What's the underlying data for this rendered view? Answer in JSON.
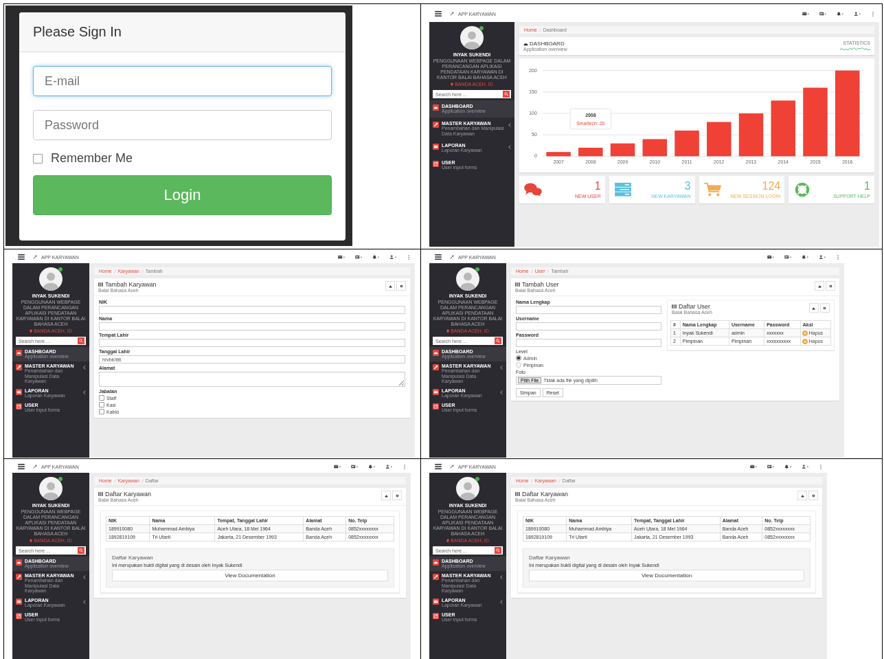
{
  "panels": [
    {
      "kind": "login",
      "title": "Please Sign In",
      "fields": [
        {
          "placeholder": "E-mail",
          "focused": true
        },
        {
          "placeholder": "Password",
          "focused": false
        }
      ],
      "remember": {
        "label": "Remember Me",
        "checked": false
      },
      "button": "Login"
    },
    {
      "kind": "app",
      "brand": "APP KARYAWAN",
      "sidebar": {
        "name": "INYAK SUKENDI",
        "description": "PENGGUNAAN WEBPAGE DALAM PERANCANGAN APLIKASI PENDATAAN KARYAWAN DI KANTOR BALAI BAHASA ACEH",
        "location": "BANDA ACEH, ID",
        "search_placeholder": "Search here ...",
        "menu": [
          {
            "title": "DASHBOARD",
            "subtitle": "Application overview",
            "selected": true,
            "has_submenu": false
          },
          {
            "title": "MASTER KARYAWAN",
            "subtitle": "Penambahan dan Manipulasi Data Karyawan",
            "selected": false,
            "has_submenu": true
          },
          {
            "title": "LAPORAN",
            "subtitle": "Laporan Karyawan",
            "selected": false,
            "has_submenu": true
          },
          {
            "title": "USER",
            "subtitle": "User input forms",
            "selected": false,
            "has_submenu": false
          }
        ]
      },
      "breadcrumb": [
        "Home",
        "Dashboard"
      ],
      "content": {
        "kind": "dashboard",
        "title": "DASHBOARD",
        "subtitle": "Application overview",
        "statistics_label": "STATISTICS",
        "chart_data": {
          "type": "bar",
          "categories": [
            "2007",
            "2008",
            "2009",
            "2010",
            "2011",
            "2012",
            "2013",
            "2014",
            "2015",
            "2016"
          ],
          "series": [
            {
              "name": "Smartech",
              "color": "#ef4136",
              "values": [
                10,
                20,
                30,
                40,
                60,
                80,
                100,
                130,
                160,
                200
              ]
            }
          ],
          "ylim": [
            0,
            200
          ],
          "yticks": [
            0,
            50,
            100,
            150,
            200
          ],
          "grid": true
        },
        "tooltip": {
          "title": "2008",
          "value": ": 20"
        },
        "stats": [
          {
            "value": "1",
            "label": "NEW USER",
            "color": "#e8453c"
          },
          {
            "value": "3",
            "label": "NEW KARYAWAN",
            "color": "#5bc0de"
          },
          {
            "value": "124",
            "label": "NEW SESSION LOGIN",
            "color": "#f0ad4e"
          },
          {
            "value": "1",
            "label": "SUPPORT HELP",
            "color": "#5cb85c"
          }
        ]
      }
    },
    {
      "kind": "app",
      "brand": "APP KARYAWAN",
      "sidebar": {
        "name": "INYAK SUKENDI",
        "description": "PENGGUNAAN WEBPAGE DALAM PERANCANGAN APLIKASI PENDATAAN KARYAWAN DI KANTOR BALAI BAHASA ACEH",
        "location": "BANDA ACEH, ID",
        "search_placeholder": "Search here ...",
        "menu": [
          {
            "title": "DASHBOARD",
            "subtitle": "Application overview",
            "selected": true,
            "has_submenu": false
          },
          {
            "title": "MASTER KARYAWAN",
            "subtitle": "Penambahan dan Manipulasi Data Karyawan",
            "selected": false,
            "has_submenu": true
          },
          {
            "title": "LAPORAN",
            "subtitle": "Laporan Karyawan",
            "selected": false,
            "has_submenu": true
          },
          {
            "title": "USER",
            "subtitle": "User input forms",
            "selected": false,
            "has_submenu": false
          }
        ]
      },
      "breadcrumb": [
        "Home",
        "Karyawan",
        "Tambah"
      ],
      "content": {
        "kind": "form",
        "title": "Tambah Karyawan",
        "subtitle": "Balai Bahasa Aceh",
        "fields": [
          {
            "kind": "text",
            "label": "NIK"
          },
          {
            "kind": "text",
            "label": "Nama"
          },
          {
            "kind": "text",
            "label": "Tempat Lahir"
          },
          {
            "kind": "date",
            "label": "Tanggal Lahir",
            "placeholder": "hh/bb/tttt"
          },
          {
            "kind": "textarea",
            "label": "Alamat"
          },
          {
            "kind": "checkboxes",
            "label": "Jabatan",
            "options": [
              {
                "label": "Staff",
                "checked": false
              },
              {
                "label": "Kasi",
                "checked": false
              },
              {
                "label": "Kabid",
                "checked": false
              }
            ]
          }
        ]
      }
    },
    {
      "kind": "app",
      "brand": "APP KARYAWAN",
      "sidebar": {
        "name": "INYAK SUKENDI",
        "description": "PENGGUNAAN WEBPAGE DALAM PERANCANGAN APLIKASI PENDATAAN KARYAWAN DI KANTOR BALAI BAHASA ACEH",
        "location": "BANDA ACEH, ID",
        "search_placeholder": "Search here ...",
        "menu": [
          {
            "title": "DASHBOARD",
            "subtitle": "Application overview",
            "selected": true,
            "has_submenu": false
          },
          {
            "title": "MASTER KARYAWAN",
            "subtitle": "Penambahan dan Manipulasi Data Karyawan",
            "selected": false,
            "has_submenu": true
          },
          {
            "title": "LAPORAN",
            "subtitle": "Laporan Karyawan",
            "selected": false,
            "has_submenu": true
          },
          {
            "title": "USER",
            "subtitle": "User input forms",
            "selected": false,
            "has_submenu": false
          }
        ]
      },
      "breadcrumb": [
        "Home",
        "User",
        "Tambah"
      ],
      "content": {
        "kind": "form",
        "title": "Tambah User",
        "subtitle": "Balai Bahasa Aceh",
        "fields": [
          {
            "kind": "text",
            "label": "Nama Lengkap"
          },
          {
            "kind": "text",
            "label": "Username"
          },
          {
            "kind": "text",
            "label": "Password"
          },
          {
            "kind": "radios",
            "label": "Level",
            "options": [
              {
                "label": "Admin",
                "selected": true
              },
              {
                "label": "Pimpinan",
                "selected": false
              }
            ]
          },
          {
            "kind": "file",
            "label": "Foto",
            "button": "Pilih File",
            "text": "Tidak ada file yang dipilih"
          }
        ],
        "buttons": [
          "Simpan",
          "Reset"
        ],
        "side_panel": {
          "title": "Daftar User",
          "subtitle": "Balai Bahasa Aceh",
          "columns": [
            "#",
            "Nama Lengkap",
            "Username",
            "Password",
            "Aksi"
          ],
          "rows": [
            {
              "cells": [
                "1",
                "Inyak Sukendi",
                "admin",
                "xxxxxxx"
              ],
              "action": "Hapus"
            },
            {
              "cells": [
                "2",
                "Pimpinan",
                "Pimpinan",
                "xxxxxxxxxx"
              ],
              "action": "Hapus"
            }
          ]
        }
      }
    },
    {
      "kind": "app",
      "brand": "APP KARYAWAN",
      "sidebar": {
        "name": "INYAK SUKENDI",
        "description": "PENGGUNAAN WEBPAGE DALAM PERANCANGAN APLIKASI PENDATAAN KARYAWAN DI KANTOR BALAI BAHASA ACEH",
        "location": "BANDA ACEH, ID",
        "search_placeholder": "Search here ...",
        "menu": [
          {
            "title": "DASHBOARD",
            "subtitle": "Application overview",
            "selected": true,
            "has_submenu": false
          },
          {
            "title": "MASTER KARYAWAN",
            "subtitle": "Penambahan dan Manipulasi Data Karyawan",
            "selected": false,
            "has_submenu": true
          },
          {
            "title": "LAPORAN",
            "subtitle": "Laporan Karyawan",
            "selected": false,
            "has_submenu": true
          },
          {
            "title": "USER",
            "subtitle": "User input forms",
            "selected": false,
            "has_submenu": false
          }
        ]
      },
      "breadcrumb": [
        "Home",
        "Karyawan",
        "Daftar"
      ],
      "content": {
        "kind": "list",
        "title": "Daftar Karyawan",
        "subtitle": "Balai Bahasa Aceh",
        "columns": [
          "NIK",
          "Nama",
          "Tempat, Tanggal Lahir",
          "Alamat",
          "No. Telp"
        ],
        "rows": [
          [
            "189910080",
            "Muhammad Ambiya",
            "Aceh Utara, 18 Mei 1964",
            "Banda Aceh",
            "0852xxxxxxxx"
          ],
          [
            "1892819109",
            "Tri Utarti",
            "Jakarta, 21 Desember 1993",
            "Banda Aceh",
            "0852xxxxxxxx"
          ]
        ],
        "note": {
          "title": "Daftar Karyawan",
          "text": "Ini merupakan bukti digital yang di desain oleh Inyak Sukendi",
          "button": "View Documentation"
        }
      }
    },
    {
      "kind": "app",
      "brand": "APP KARYAWAN",
      "sidebar": {
        "name": "INYAK SUKENDI",
        "description": "PENGGUNAAN WEBPAGE DALAM PERANCANGAN APLIKASI PENDATAAN KARYAWAN DI KANTOR BALAI BAHASA ACEH",
        "location": "BANDA ACEH, ID",
        "search_placeholder": "Search here ...",
        "menu": [
          {
            "title": "DASHBOARD",
            "subtitle": "Application overview",
            "selected": true,
            "has_submenu": false
          },
          {
            "title": "MASTER KARYAWAN",
            "subtitle": "Penambahan dan Manipulasi Data Karyawan",
            "selected": false,
            "has_submenu": true
          },
          {
            "title": "LAPORAN",
            "subtitle": "Laporan Karyawan",
            "selected": false,
            "has_submenu": true
          },
          {
            "title": "USER",
            "subtitle": "User input forms",
            "selected": false,
            "has_submenu": false
          }
        ]
      },
      "breadcrumb": [
        "Home",
        "Karyawan",
        "Daftar"
      ],
      "content": {
        "kind": "list",
        "title": "Daftar Karyawan",
        "subtitle": "Balai Bahasa Aceh",
        "columns": [
          "NIK",
          "Nama",
          "Tempat, Tanggal Lahir",
          "Alamat",
          "No. Telp"
        ],
        "rows": [
          [
            "189910080",
            "Muhammad Ambiya",
            "Aceh Utara, 18 Mei 1964",
            "Banda Aceh",
            "0852xxxxxxxx"
          ],
          [
            "1892819109",
            "Tri Utarti",
            "Jakarta, 21 Desember 1993",
            "Banda Aceh",
            "0852xxxxxxxx"
          ]
        ],
        "note": {
          "title": "Daftar Karyawan",
          "text": "Ini merupakan bukti digital yang di desain oleh Inyak Sukendi",
          "button": "View Documentation"
        }
      }
    }
  ]
}
